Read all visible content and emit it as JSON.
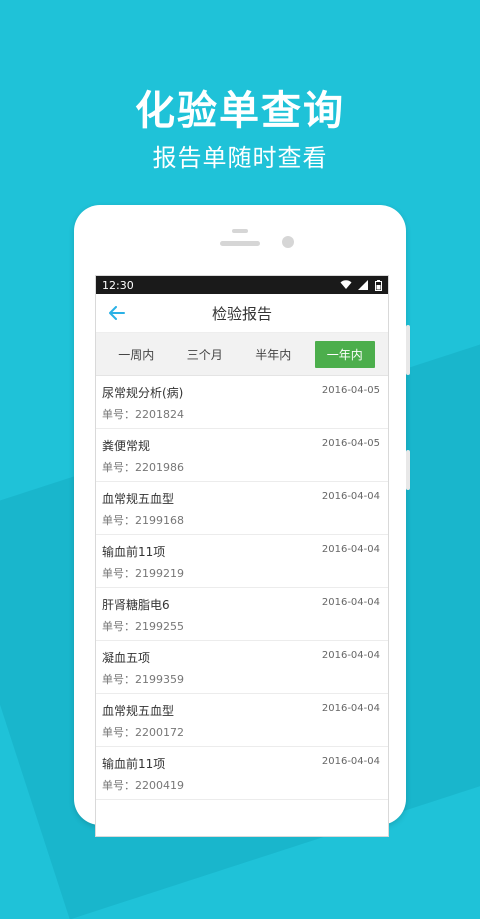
{
  "promo": {
    "title": "化验单查询",
    "subtitle": "报告单随时查看"
  },
  "colors": {
    "background": "#1fc2d8",
    "accent_back": "#2ab1e6",
    "active_tab": "#4cae4c"
  },
  "statusbar": {
    "time": "12:30",
    "icons": [
      "wifi-icon",
      "signal-icon",
      "battery-icon"
    ]
  },
  "appbar": {
    "back_icon": "back-arrow-icon",
    "title": "检验报告"
  },
  "tabs": [
    {
      "label": "一周内",
      "active": false
    },
    {
      "label": "三个月",
      "active": false
    },
    {
      "label": "半年内",
      "active": false
    },
    {
      "label": "一年内",
      "active": true
    }
  ],
  "reports": [
    {
      "name": "尿常规分析(病)",
      "number": "单号：2201824",
      "date": "2016-04-05"
    },
    {
      "name": "粪便常规",
      "number": "单号：2201986",
      "date": "2016-04-05"
    },
    {
      "name": "血常规五血型",
      "number": "单号：2199168",
      "date": "2016-04-04"
    },
    {
      "name": "输血前11项",
      "number": "单号：2199219",
      "date": "2016-04-04"
    },
    {
      "name": "肝肾糖脂电6",
      "number": "单号：2199255",
      "date": "2016-04-04"
    },
    {
      "name": "凝血五项",
      "number": "单号：2199359",
      "date": "2016-04-04"
    },
    {
      "name": "血常规五血型",
      "number": "单号：2200172",
      "date": "2016-04-04"
    },
    {
      "name": "输血前11项",
      "number": "单号：2200419",
      "date": "2016-04-04"
    }
  ]
}
